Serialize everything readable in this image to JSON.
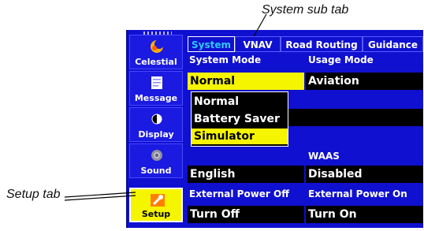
{
  "annotations": {
    "system_sub_tab": "System sub tab",
    "setup_tab": "Setup tab"
  },
  "sidebar": {
    "items": [
      {
        "label": "Celestial",
        "icon": "celestial-icon"
      },
      {
        "label": "Message",
        "icon": "message-icon"
      },
      {
        "label": "Display",
        "icon": "display-icon"
      },
      {
        "label": "Sound",
        "icon": "sound-icon"
      },
      {
        "label": "Setup",
        "icon": "setup-icon",
        "active": true
      }
    ]
  },
  "tabs": [
    {
      "label": "System",
      "active": true
    },
    {
      "label": "VNAV"
    },
    {
      "label": "Road Routing"
    },
    {
      "label": "Guidance"
    }
  ],
  "system": {
    "system_mode_label": "System Mode",
    "system_mode_value": "Normal",
    "usage_mode_label": "Usage Mode",
    "usage_mode_value": "Aviation",
    "dropdown_options": [
      "Normal",
      "Battery Saver",
      "Simulator"
    ],
    "dropdown_selected": "Simulator",
    "language_value": "English",
    "waas_label": "WAAS",
    "waas_value": "Disabled",
    "ext_power_off_label": "External Power Off",
    "ext_power_off_value": "Turn Off",
    "ext_power_on_label": "External Power On",
    "ext_power_on_value": "Turn On"
  },
  "colors": {
    "screen_bg": "#1010d0",
    "highlight": "#f5f500",
    "active_tab_text": "#30c8ff"
  }
}
